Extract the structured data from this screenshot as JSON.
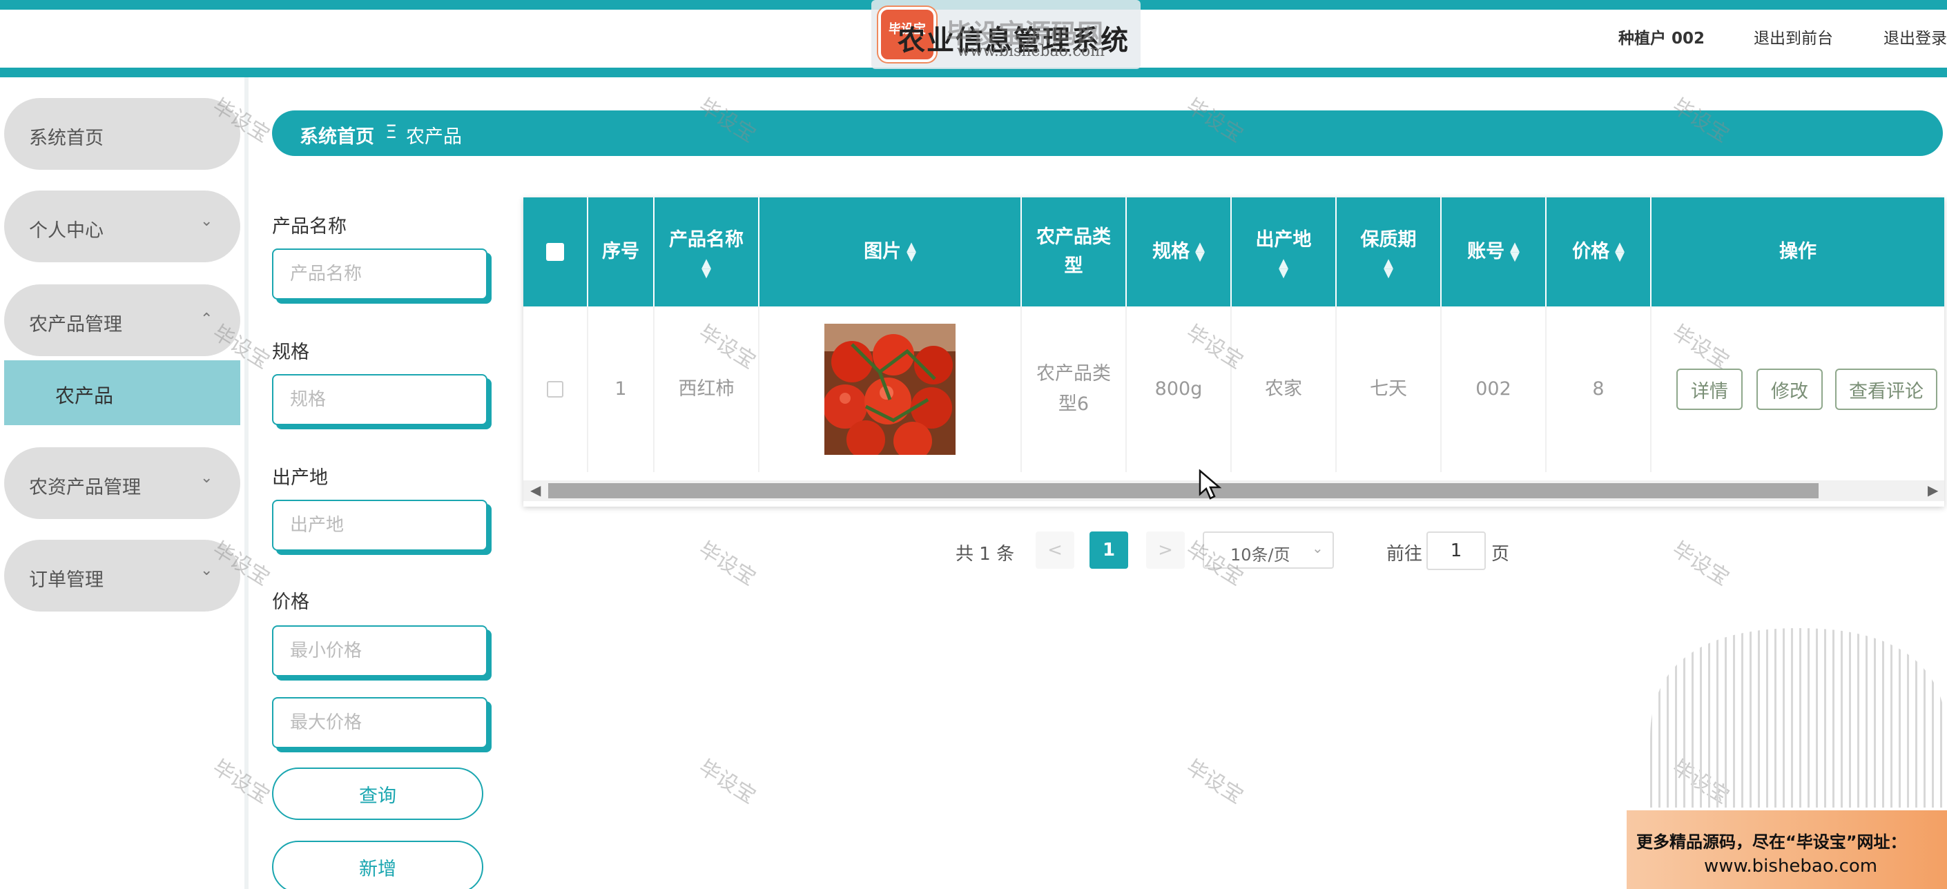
{
  "header": {
    "app_title": "农业信息管理系统",
    "logo_badge": "毕设宝",
    "logo_name": "毕设宝源码网",
    "logo_url": "www.bishebao.com",
    "user": "种植户 002",
    "front_link": "退出到前台",
    "logout_link": "退出登录"
  },
  "sidebar": {
    "items": [
      {
        "label": "系统首页"
      },
      {
        "label": "个人中心"
      },
      {
        "label": "农产品管理"
      },
      {
        "label": "农资产品管理"
      },
      {
        "label": "订单管理"
      }
    ],
    "subitem": "农产品"
  },
  "breadcrumb": {
    "home": "系统首页",
    "separator": "Ξ",
    "current": "农产品"
  },
  "filters": {
    "product_name_label": "产品名称",
    "product_name_placeholder": "产品名称",
    "spec_label": "规格",
    "spec_placeholder": "规格",
    "origin_label": "出产地",
    "origin_placeholder": "出产地",
    "price_label": "价格",
    "min_price_placeholder": "最小价格",
    "max_price_placeholder": "最大价格",
    "query_button": "查询",
    "add_button": "新增"
  },
  "table": {
    "headers": {
      "seq": "序号",
      "name": "产品名称",
      "image": "图片",
      "type": "农产品类型",
      "spec": "规格",
      "origin": "出产地",
      "shelf": "保质期",
      "account": "账号",
      "price": "价格",
      "ops": "操作"
    },
    "rows": [
      {
        "seq": "1",
        "name": "西红柿",
        "type": "农产品类型6",
        "spec": "800g",
        "origin": "农家",
        "shelf": "七天",
        "account": "002",
        "price": "8"
      }
    ],
    "ops": {
      "detail": "详情",
      "edit": "修改",
      "comments": "查看评论"
    }
  },
  "pagination": {
    "total": "共 1 条",
    "current_page": "1",
    "page_size": "10条/页",
    "goto_label": "前往",
    "goto_value": "1",
    "page_suffix": "页"
  },
  "watermark": "毕设宝",
  "banner": {
    "line1": "更多精品源码，尽在“毕设宝”网址：",
    "line2": "www.bishebao.com"
  },
  "colors": {
    "accent": "#1aa6b0",
    "active_sub": "#8dcfd6",
    "sidebar_item": "#dedede",
    "banner": "#f5b27f"
  },
  "icons": [
    "chevron-down-icon",
    "chevron-up-icon",
    "sort-icon",
    "scroll-left-icon",
    "scroll-right-icon",
    "cursor-icon"
  ]
}
